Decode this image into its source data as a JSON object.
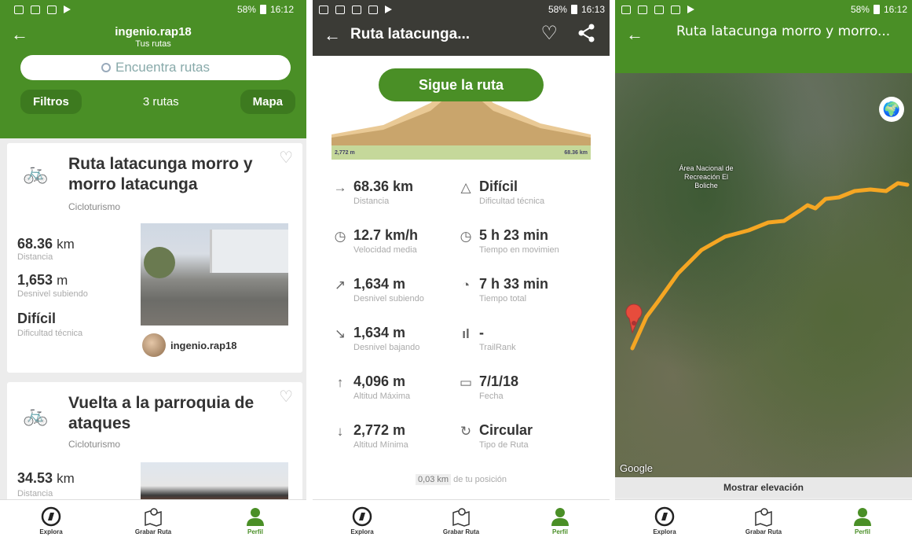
{
  "status": {
    "p1": {
      "battery": "58%",
      "time": "16:12"
    },
    "p2": {
      "battery": "58%",
      "time": "16:13"
    },
    "p3": {
      "battery": "58%",
      "time": "16:12"
    }
  },
  "screen1": {
    "user": "ingenio.rap18",
    "subtitle": "Tus rutas",
    "search_placeholder": "Encuentra rutas",
    "filters_label": "Filtros",
    "count_label": "3 rutas",
    "map_label": "Mapa",
    "routes": [
      {
        "title": "Ruta latacunga morro y morro latacunga",
        "category": "Cicloturismo",
        "distance_value": "68.36",
        "distance_unit": "km",
        "distance_label": "Distancia",
        "ascent_value": "1,653",
        "ascent_unit": "m",
        "ascent_label": "Desnivel subiendo",
        "difficulty": "Difícil",
        "difficulty_label": "Dificultad técnica",
        "author": "ingenio.rap18"
      },
      {
        "title": "Vuelta a la parroquia de ataques",
        "category": "Cicloturismo",
        "distance_value": "34.53",
        "distance_unit": "km",
        "distance_label": "Distancia"
      }
    ]
  },
  "screen2": {
    "title": "Ruta latacunga...",
    "follow_label": "Sigue la ruta",
    "elev_min_label": "2,772 m",
    "elev_max_label": "68.36 km",
    "stats": [
      {
        "icon": "distance-icon",
        "value": "68.36 km",
        "label": "Distancia"
      },
      {
        "icon": "difficulty-icon",
        "value": "Difícil",
        "label": "Dificultad técnica"
      },
      {
        "icon": "speed-icon",
        "value": "12.7 km/h",
        "label": "Velocidad media"
      },
      {
        "icon": "moving-time-icon",
        "value": "5 h 23 min",
        "label": "Tiempo en movimien"
      },
      {
        "icon": "ascent-icon",
        "value": "1,634 m",
        "label": "Desnivel subiendo"
      },
      {
        "icon": "total-time-icon",
        "value": "7 h 33 min",
        "label": "Tiempo total"
      },
      {
        "icon": "descent-icon",
        "value": "1,634 m",
        "label": "Desnivel bajando"
      },
      {
        "icon": "trailrank-icon",
        "value": "-",
        "label": "TrailRank"
      },
      {
        "icon": "max-altitude-icon",
        "value": "4,096 m",
        "label": "Altitud Máxima"
      },
      {
        "icon": "calendar-icon",
        "value": "7/1/18",
        "label": "Fecha"
      },
      {
        "icon": "min-altitude-icon",
        "value": "2,772 m",
        "label": "Altitud Mínima"
      },
      {
        "icon": "circular-icon",
        "value": "Circular",
        "label": "Tipo de Ruta"
      }
    ],
    "position_value": "0,03 km",
    "position_text": "de tu posición"
  },
  "screen3": {
    "title": "Ruta latacunga morro y morro...",
    "area_label": "Área Nacional de Recreación El Boliche",
    "google_label": "Google",
    "elevation_button": "Mostrar elevación"
  },
  "nav": {
    "explore": "Explora",
    "record": "Grabar Ruta",
    "profile": "Perfil"
  },
  "colors": {
    "brand_green": "#4a8f26",
    "route_orange": "#f5a623"
  }
}
